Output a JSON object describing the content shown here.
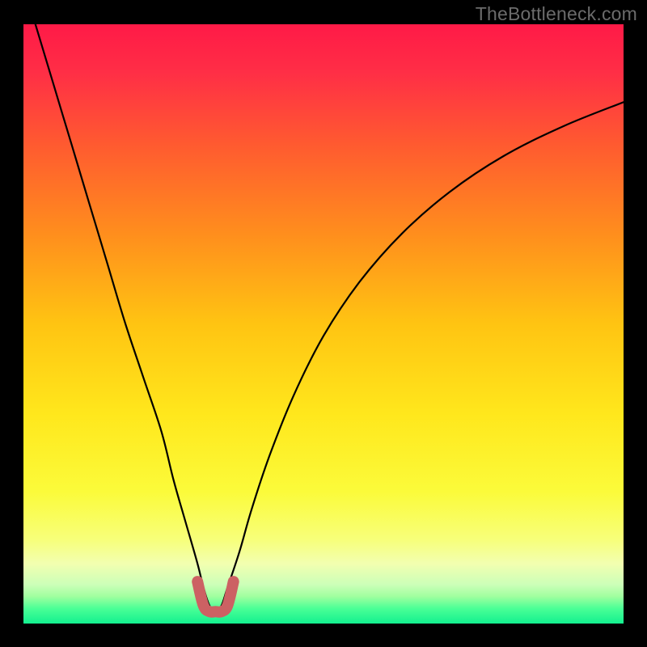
{
  "watermark": "TheBottleneck.com",
  "colors": {
    "background_black": "#000000",
    "gradient_stops": [
      {
        "pos": 0.0,
        "color": "#ff1a47"
      },
      {
        "pos": 0.08,
        "color": "#ff2e46"
      },
      {
        "pos": 0.2,
        "color": "#ff5a30"
      },
      {
        "pos": 0.35,
        "color": "#ff8e1d"
      },
      {
        "pos": 0.5,
        "color": "#ffc412"
      },
      {
        "pos": 0.65,
        "color": "#ffe71c"
      },
      {
        "pos": 0.78,
        "color": "#fbfb3a"
      },
      {
        "pos": 0.86,
        "color": "#f7ff7a"
      },
      {
        "pos": 0.9,
        "color": "#f2ffb0"
      },
      {
        "pos": 0.935,
        "color": "#ccffb8"
      },
      {
        "pos": 0.955,
        "color": "#9fff9f"
      },
      {
        "pos": 0.975,
        "color": "#4aff96"
      },
      {
        "pos": 1.0,
        "color": "#13f08f"
      }
    ],
    "curve": "#000000",
    "highlight": "#cc6163"
  },
  "chart_data": {
    "type": "line",
    "title": "",
    "xlabel": "",
    "ylabel": "",
    "xlim": [
      0,
      100
    ],
    "ylim": [
      0,
      100
    ],
    "series": [
      {
        "name": "bottleneck-curve",
        "x": [
          2,
          5,
          8,
          11,
          14,
          17,
          20,
          23,
          25,
          27,
          29,
          30,
          31,
          32,
          33,
          34,
          36,
          38,
          41,
          45,
          50,
          56,
          63,
          71,
          80,
          90,
          100
        ],
        "y": [
          100,
          90,
          80,
          70,
          60,
          50,
          41,
          32,
          24,
          17,
          10,
          6,
          3,
          2,
          3,
          6,
          12,
          19,
          28,
          38,
          48,
          57,
          65,
          72,
          78,
          83,
          87
        ]
      },
      {
        "name": "highlight-zone",
        "x": [
          29,
          30,
          31,
          32,
          33,
          34,
          35
        ],
        "y": [
          7,
          3,
          2,
          2,
          2,
          3,
          7
        ]
      }
    ],
    "annotations": [],
    "notes": "y is bottleneck percentage (0 = no bottleneck, at green band bottom); curve minimum near x≈32."
  }
}
